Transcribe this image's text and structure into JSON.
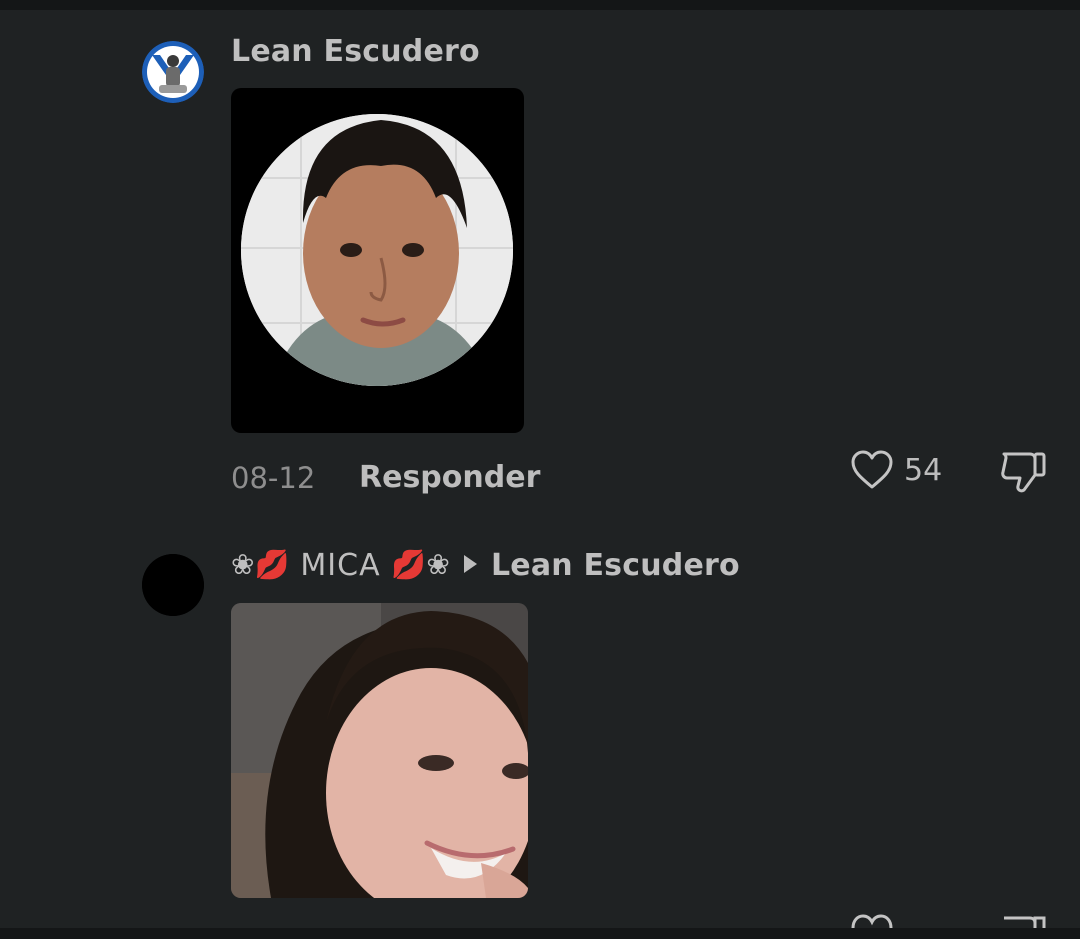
{
  "comments": [
    {
      "username": "Lean Escudero",
      "date": "08-12",
      "reply_label": "Responder",
      "likes": "54",
      "avatar_icon": "club-crest-avatar",
      "photo_description_icon": "profile-photo-circle"
    },
    {
      "username_prefix": "❀💋",
      "username": "MICA",
      "username_suffix": "💋❀",
      "reply_to": "Lean Escudero",
      "avatar_icon": "black-circle-avatar"
    }
  ],
  "colors": {
    "background": "#1f2223",
    "text_primary": "#bfbfbf",
    "text_secondary": "#8e8e8e"
  }
}
